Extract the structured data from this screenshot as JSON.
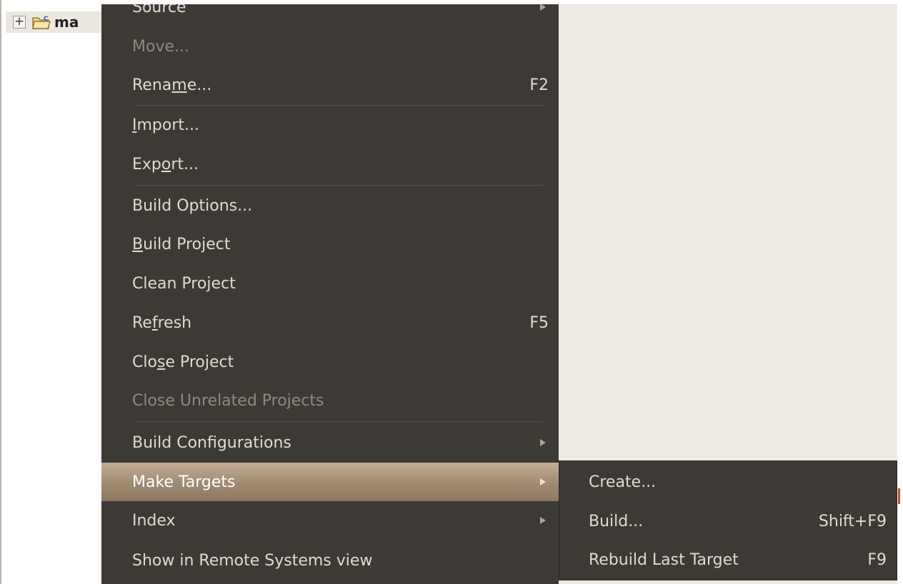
{
  "tree": {
    "expander": "+",
    "project_name": "ma"
  },
  "menu": {
    "items": [
      {
        "label": "Source",
        "accel": "",
        "submenu": true,
        "disabled": false
      },
      {
        "label": "Move...",
        "accel": "",
        "submenu": false,
        "disabled": true
      },
      {
        "label_pre": "Rena",
        "mnemonic": "m",
        "label_post": "e...",
        "accel": "F2"
      },
      {
        "label_pre": "",
        "mnemonic": "I",
        "label_post": "mport...",
        "accel": ""
      },
      {
        "label_pre": "Exp",
        "mnemonic": "o",
        "label_post": "rt...",
        "accel": ""
      },
      {
        "label": "Build Options...",
        "accel": ""
      },
      {
        "label_pre": "",
        "mnemonic": "B",
        "label_post": "uild Project",
        "accel": ""
      },
      {
        "label": "Clean Project",
        "accel": ""
      },
      {
        "label_pre": "Re",
        "mnemonic": "f",
        "label_post": "resh",
        "accel": "F5"
      },
      {
        "label_pre": "Clo",
        "mnemonic": "s",
        "label_post": "e Project",
        "accel": ""
      },
      {
        "label": "Close Unrelated Projects",
        "disabled": true
      },
      {
        "label": "Build Configurations",
        "submenu": true
      },
      {
        "label": "Make Targets",
        "submenu": true,
        "highlighted": true
      },
      {
        "label": "Index",
        "submenu": true
      },
      {
        "label": "Show in Remote Systems view"
      }
    ]
  },
  "submenu": {
    "items": [
      {
        "label": "Create...",
        "accel": ""
      },
      {
        "label": "Build...",
        "accel": "Shift+F9"
      },
      {
        "label": "Rebuild Last Target",
        "accel": "F9"
      }
    ]
  },
  "colors": {
    "menu_bg": "#3d3a36",
    "menu_text": "#dfdbd2",
    "disabled_text": "#8d8880",
    "highlight": "#a08a72",
    "window_bg": "#ede9e3"
  }
}
